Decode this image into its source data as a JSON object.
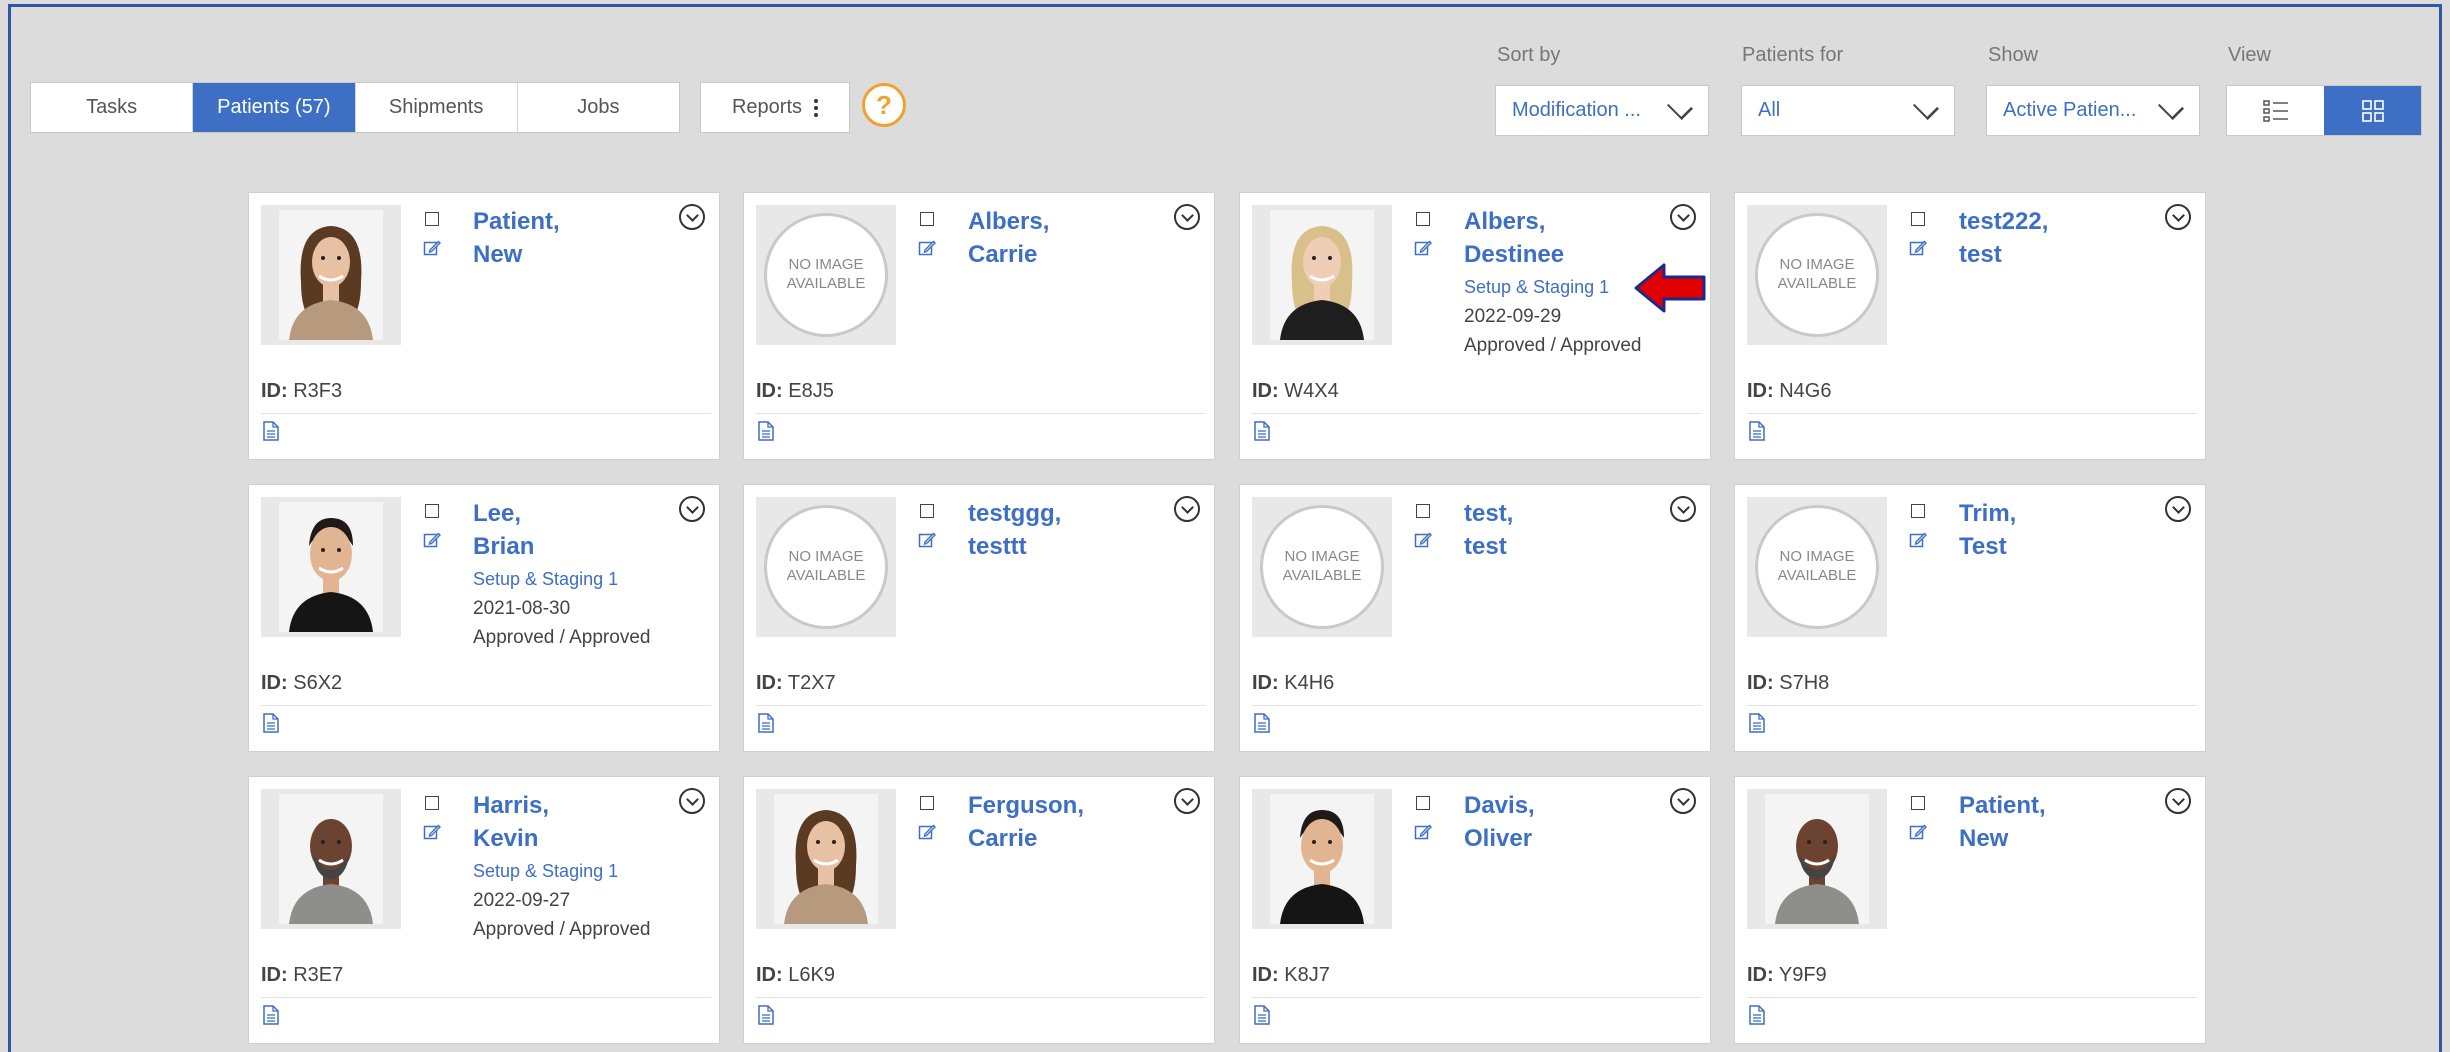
{
  "tabs": [
    {
      "label": "Tasks",
      "active": false
    },
    {
      "label": "Patients (57)",
      "active": true
    },
    {
      "label": "Shipments",
      "active": false
    },
    {
      "label": "Jobs",
      "active": false
    }
  ],
  "reports_label": "Reports",
  "help_label": "?",
  "controls": {
    "sort_by": {
      "label": "Sort by",
      "value": "Modification ..."
    },
    "patients_for": {
      "label": "Patients for",
      "value": "All"
    },
    "show": {
      "label": "Show",
      "value": "Active Patien..."
    },
    "view": {
      "label": "View",
      "active": "grid"
    }
  },
  "id_label": "ID:",
  "no_image_line1": "NO IMAGE",
  "no_image_line2": "AVAILABLE",
  "colors": {
    "accent": "#3d6fc4",
    "help": "#f0a22e",
    "arrow": "#e00000"
  },
  "patients": [
    {
      "last": "Patient,",
      "first": "New",
      "id": "R3F3",
      "photo": "woman-brunette",
      "stage": "",
      "date": "",
      "approval": ""
    },
    {
      "last": "Albers,",
      "first": "Carrie",
      "id": "E8J5",
      "photo": "none",
      "stage": "",
      "date": "",
      "approval": ""
    },
    {
      "last": "Albers,",
      "first": "Destinee",
      "id": "W4X4",
      "photo": "woman-blonde",
      "stage": "Setup & Staging 1",
      "date": "2022-09-29",
      "approval": "Approved / Approved"
    },
    {
      "last": "test222,",
      "first": "test",
      "id": "N4G6",
      "photo": "none",
      "stage": "",
      "date": "",
      "approval": ""
    },
    {
      "last": "Lee,",
      "first": "Brian",
      "id": "S6X2",
      "photo": "man-asian",
      "stage": "Setup & Staging 1",
      "date": "2021-08-30",
      "approval": "Approved / Approved"
    },
    {
      "last": "testggg,",
      "first": "testtt",
      "id": "T2X7",
      "photo": "none",
      "stage": "",
      "date": "",
      "approval": ""
    },
    {
      "last": "test,",
      "first": "test",
      "id": "K4H6",
      "photo": "none",
      "stage": "",
      "date": "",
      "approval": ""
    },
    {
      "last": "Trim,",
      "first": "Test",
      "id": "S7H8",
      "photo": "none",
      "stage": "",
      "date": "",
      "approval": ""
    },
    {
      "last": "Harris,",
      "first": "Kevin",
      "id": "R3E7",
      "photo": "man-bald",
      "stage": "Setup & Staging 1",
      "date": "2022-09-27",
      "approval": "Approved / Approved"
    },
    {
      "last": "Ferguson,",
      "first": "Carrie",
      "id": "L6K9",
      "photo": "woman-brunette",
      "stage": "",
      "date": "",
      "approval": ""
    },
    {
      "last": "Davis,",
      "first": "Oliver",
      "id": "K8J7",
      "photo": "man-asian",
      "stage": "",
      "date": "",
      "approval": ""
    },
    {
      "last": "Patient,",
      "first": "New",
      "id": "Y9F9",
      "photo": "man-bald",
      "stage": "",
      "date": "",
      "approval": ""
    }
  ]
}
